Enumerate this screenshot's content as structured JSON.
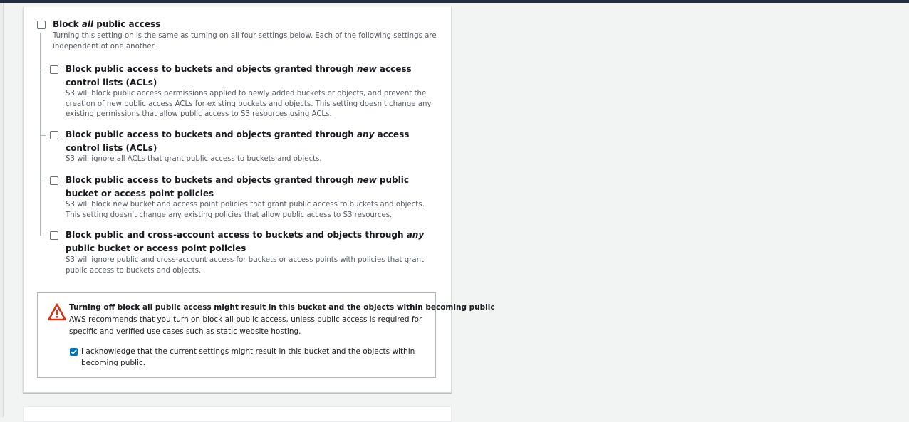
{
  "block_all": {
    "title_pre": "Block ",
    "title_em": "all",
    "title_post": " public access",
    "description": "Turning this setting on is the same as turning on all four settings below. Each of the following settings are independent of one another.",
    "checked": false
  },
  "settings": [
    {
      "title_pre": "Block public access to buckets and objects granted through ",
      "title_em": "new",
      "title_post": " access control lists (ACLs)",
      "description": "S3 will block public access permissions applied to newly added buckets or objects, and prevent the creation of new public access ACLs for existing buckets and objects. This setting doesn't change any existing permissions that allow public access to S3 resources using ACLs.",
      "checked": false
    },
    {
      "title_pre": "Block public access to buckets and objects granted through ",
      "title_em": "any",
      "title_post": " access control lists (ACLs)",
      "description": "S3 will ignore all ACLs that grant public access to buckets and objects.",
      "checked": false
    },
    {
      "title_pre": "Block public access to buckets and objects granted through ",
      "title_em": "new",
      "title_post": " public bucket or access point policies",
      "description": "S3 will block new bucket and access point policies that grant public access to buckets and objects. This setting doesn't change any existing policies that allow public access to S3 resources.",
      "checked": false
    },
    {
      "title_pre": "Block public and cross-account access to buckets and objects through ",
      "title_em": "any",
      "title_post": " public bucket or access point policies",
      "description": "S3 will ignore public and cross-account access for buckets or access points with policies that grant public access to buckets and objects.",
      "checked": false
    }
  ],
  "warning": {
    "icon": "warning-triangle-icon",
    "title": "Turning off block all public access might result in this bucket and the objects within becoming public",
    "text": "AWS recommends that you turn on block all public access, unless public access is required for specific and verified use cases such as static website hosting.",
    "acknowledge_label": "I acknowledge that the current settings might result in this bucket and the objects within becoming public.",
    "acknowledge_checked": true
  },
  "colors": {
    "warning_red": "#d13212",
    "checkbox_blue": "#0073bb"
  }
}
